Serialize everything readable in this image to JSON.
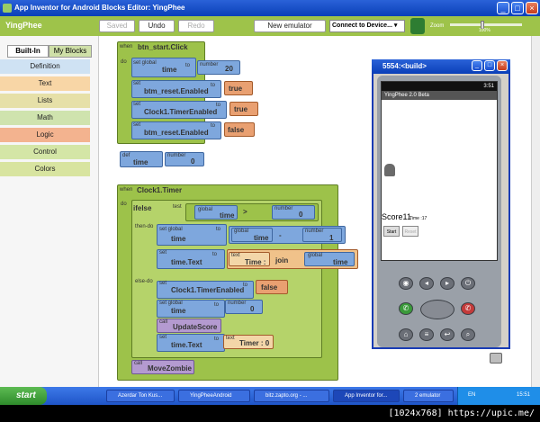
{
  "window": {
    "title": "App Inventor for Android Blocks Editor: YingPhee"
  },
  "toolbar": {
    "app_name": "YingPhee",
    "saved": "Saved",
    "undo": "Undo",
    "redo": "Redo",
    "new_emulator": "New emulator",
    "connect": "Connect to Device...",
    "zoom_label": "Zoom",
    "zoom_pct": "100%"
  },
  "palette": {
    "tabs": [
      "Built-In",
      "My Blocks"
    ],
    "categories": [
      "Definition",
      "Text",
      "Lists",
      "Math",
      "Logic",
      "Control",
      "Colors"
    ]
  },
  "blocks": {
    "when": "when",
    "do": "do",
    "def": "def",
    "set": "set",
    "set_global": "set global",
    "to": "to",
    "number": "number",
    "call": "call",
    "test": "test",
    "global": "global",
    "start_click": "btn_start.Click",
    "time": "time",
    "val20": "20",
    "btn_reset_enabled": "btm_reset.Enabled",
    "true": "true",
    "false": "false",
    "clock_enabled": "Clock1.TimerEnabled",
    "val0": "0",
    "clock_timer": "Clock1.Timer",
    "ifelse": "ifelse",
    "then_do": "then-do",
    "else_do": "else-do",
    "gt": ">",
    "minus": "-",
    "val1": "1",
    "time_text": "time.Text",
    "text": "text",
    "time_str": "Time :",
    "join": "join",
    "update_score": "UpdateScore",
    "timer0": "Timer : 0",
    "move_zombie": "MoveZombie"
  },
  "emulator": {
    "title": "5554:<build>",
    "time": "3:51",
    "app_title": "YingPhee 2.0 Beta",
    "score": "Score11",
    "time_label": "Time :17",
    "start": "Start",
    "reset": "Reset"
  },
  "taskbar": {
    "start": "start",
    "items": [
      "Azerdar Ton Kus...",
      "YingPheeAndroid",
      "bitz.zapto.org - ...",
      "App Inventor for...",
      "2 emulator"
    ],
    "lang": "EN",
    "clock": "15:51"
  },
  "watermark": "[1024x768] https://upic.me/"
}
